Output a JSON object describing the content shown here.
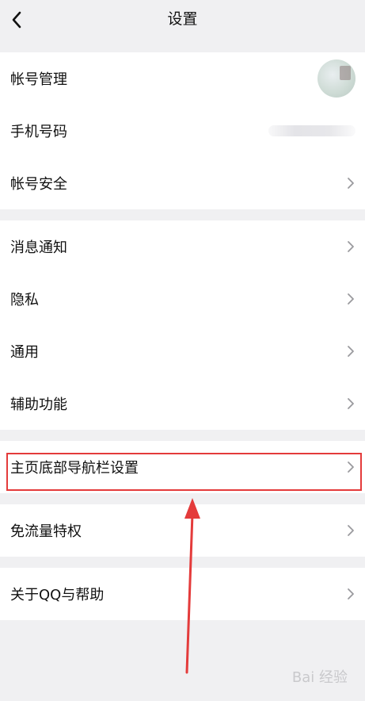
{
  "header": {
    "title": "设置"
  },
  "groups": {
    "account": [
      {
        "label": "帐号管理"
      },
      {
        "label": "手机号码"
      },
      {
        "label": "帐号安全"
      }
    ],
    "general": [
      {
        "label": "消息通知"
      },
      {
        "label": "隐私"
      },
      {
        "label": "通用"
      },
      {
        "label": "辅助功能"
      }
    ],
    "nav": [
      {
        "label": "主页底部导航栏设置"
      }
    ],
    "traffic": [
      {
        "label": "免流量特权"
      }
    ],
    "about": [
      {
        "label": "关于QQ与帮助"
      }
    ]
  },
  "watermark": "Bai 经验",
  "colors": {
    "highlight": "#e43b3b",
    "background": "#f0f0f2"
  }
}
